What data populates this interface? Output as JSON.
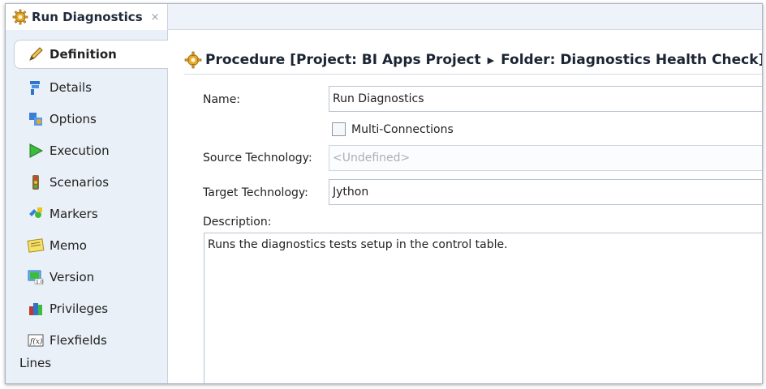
{
  "tab": {
    "title": "Run Diagnostics",
    "close_glyph": "×"
  },
  "nav": {
    "items": [
      {
        "label": "Definition",
        "icon": "pencil-icon",
        "active": true
      },
      {
        "label": "Details",
        "icon": "details-icon"
      },
      {
        "label": "Options",
        "icon": "options-icon"
      },
      {
        "label": "Execution",
        "icon": "play-icon"
      },
      {
        "label": "Scenarios",
        "icon": "traffic-light-icon"
      },
      {
        "label": "Markers",
        "icon": "markers-icon"
      },
      {
        "label": "Memo",
        "icon": "memo-icon"
      },
      {
        "label": "Version",
        "icon": "version-icon"
      },
      {
        "label": "Privileges",
        "icon": "privileges-icon"
      },
      {
        "label": "Flexfields",
        "icon": "flexfields-icon"
      }
    ],
    "section_label": "Lines"
  },
  "header": {
    "prefix": "Procedure [Project: BI Apps Project",
    "suffix": "Folder: Diagnostics Health Check]"
  },
  "form": {
    "name_label": "Name:",
    "name_value": "Run Diagnostics",
    "multi_label": "Multi-Connections",
    "source_label": "Source Technology:",
    "source_value": "<Undefined>",
    "target_label": "Target Technology:",
    "target_value": "Jython",
    "description_label": "Description:",
    "description_value": "Runs the diagnostics tests setup in the control table."
  },
  "colors": {
    "accent": "#eaf0f7",
    "border": "#b9c3cf"
  }
}
